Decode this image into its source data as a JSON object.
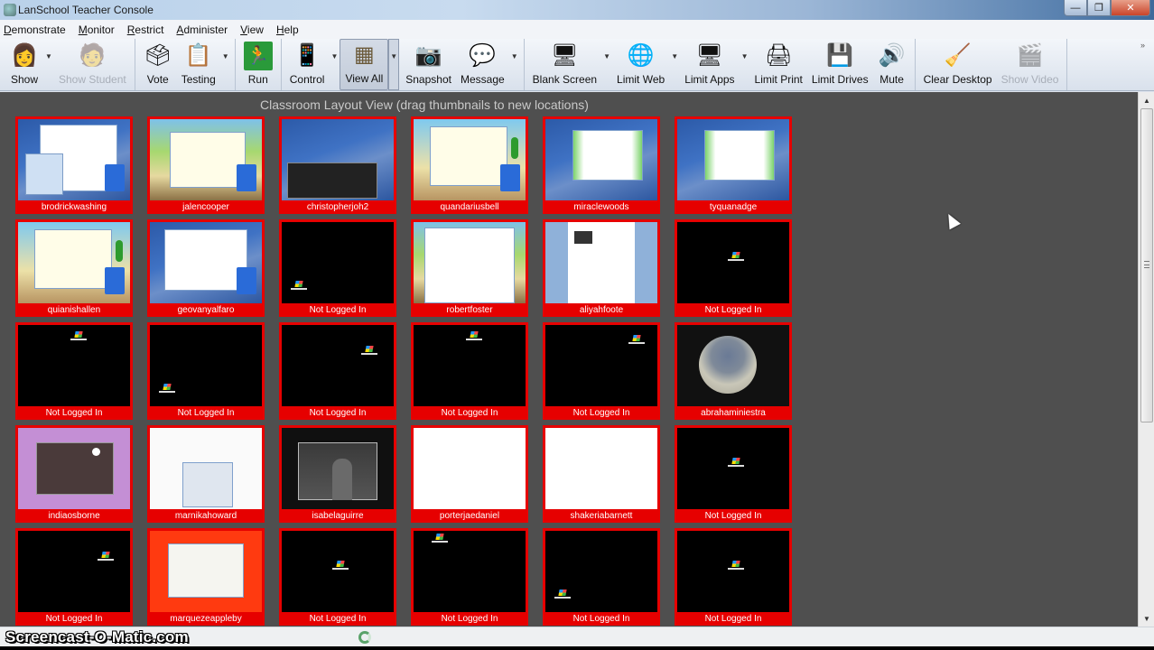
{
  "window": {
    "title": "LanSchool Teacher Console",
    "controls": {
      "minimize": "—",
      "restore": "❐",
      "close": "✕"
    }
  },
  "menu": [
    "Demonstrate",
    "Monitor",
    "Restrict",
    "Administer",
    "View",
    "Help"
  ],
  "toolbar": {
    "show": {
      "label": "Show",
      "icon": "teacher-screen-icon",
      "glyph": "👩"
    },
    "show_student": {
      "label": "Show Student",
      "icon": "student-screen-icon",
      "glyph": "🧑",
      "disabled": true
    },
    "vote": {
      "label": "Vote",
      "icon": "vote-icon",
      "glyph": "🗳"
    },
    "testing": {
      "label": "Testing",
      "icon": "testing-icon",
      "glyph": "📋"
    },
    "run": {
      "label": "Run",
      "icon": "run-exit-icon",
      "glyph": "🏃"
    },
    "control": {
      "label": "Control",
      "icon": "remote-control-icon",
      "glyph": "📱"
    },
    "view_all": {
      "label": "View All",
      "icon": "view-all-grid-icon",
      "glyph": "▦",
      "active": true
    },
    "snapshot": {
      "label": "Snapshot",
      "icon": "camera-icon",
      "glyph": "📷"
    },
    "message": {
      "label": "Message",
      "icon": "message-icon",
      "glyph": "💬"
    },
    "blank_screen": {
      "label": "Blank Screen",
      "icon": "blank-screen-lock-icon",
      "glyph": "🖥"
    },
    "limit_web": {
      "label": "Limit Web",
      "icon": "globe-block-icon",
      "glyph": "🌐"
    },
    "limit_apps": {
      "label": "Limit Apps",
      "icon": "apps-block-icon",
      "glyph": "🖥"
    },
    "limit_print": {
      "label": "Limit Print",
      "icon": "printer-block-icon",
      "glyph": "🖨"
    },
    "limit_drives": {
      "label": "Limit Drives",
      "icon": "drive-block-icon",
      "glyph": "💾"
    },
    "mute": {
      "label": "Mute",
      "icon": "speaker-icon",
      "glyph": "🔊"
    },
    "clear_desktop": {
      "label": "Clear Desktop",
      "icon": "broom-desktop-icon",
      "glyph": "🧹"
    },
    "show_video": {
      "label": "Show Video",
      "icon": "video-icon",
      "glyph": "🎬",
      "disabled": true
    },
    "overflow": "»",
    "dropdown": "▼"
  },
  "content": {
    "caption": "Classroom Layout View (drag thumbnails to new locations)",
    "tiles": [
      {
        "label": "brodrickwashing",
        "screen": "math-calculator"
      },
      {
        "label": "jalencooper",
        "screen": "game-window"
      },
      {
        "label": "christopherjoh2",
        "screen": "xp-video"
      },
      {
        "label": "quandariusbell",
        "screen": "desert-game"
      },
      {
        "label": "miraclewoods",
        "screen": "xp-game"
      },
      {
        "label": "tyquanadge",
        "screen": "xp-game"
      },
      {
        "label": "quianishallen",
        "screen": "desert-game"
      },
      {
        "label": "geovanyalfaro",
        "screen": "xp-math"
      },
      {
        "label": "Not Logged In",
        "screen": "black-logo-bl"
      },
      {
        "label": "robertfoster",
        "screen": "game-doc"
      },
      {
        "label": "aliyahfoote",
        "screen": "word-doc"
      },
      {
        "label": "Not Logged In",
        "screen": "black-logo-center"
      },
      {
        "label": "Not Logged In",
        "screen": "black-logo-top"
      },
      {
        "label": "Not Logged In",
        "screen": "black-logo-bl"
      },
      {
        "label": "Not Logged In",
        "screen": "black-logo-right"
      },
      {
        "label": "Not Logged In",
        "screen": "black-logo-top"
      },
      {
        "label": "Not Logged In",
        "screen": "black-logo-tr"
      },
      {
        "label": "abrahaminiestra",
        "screen": "sniper-game"
      },
      {
        "label": "indiaosborne",
        "screen": "purple-drawing"
      },
      {
        "label": "marnikahoward",
        "screen": "reading-doc"
      },
      {
        "label": "isabelaguirre",
        "screen": "video-person"
      },
      {
        "label": "porterjaedaniel",
        "screen": "white-quiz"
      },
      {
        "label": "shakeriabarnett",
        "screen": "white-quiz"
      },
      {
        "label": "Not Logged In",
        "screen": "black-logo-center"
      },
      {
        "label": "Not Logged In",
        "screen": "black-logo-right"
      },
      {
        "label": "marquezeappleby",
        "screen": "red-slide"
      },
      {
        "label": "Not Logged In",
        "screen": "black-logo-center"
      },
      {
        "label": "Not Logged In",
        "screen": "black-logo-tl"
      },
      {
        "label": "Not Logged In",
        "screen": "black-logo-bl"
      },
      {
        "label": "Not Logged In",
        "screen": "black-logo-center"
      }
    ]
  },
  "colors": {
    "tile_border": "#e60000",
    "workspace": "#4f4f4f"
  },
  "watermark": "Screencast-O-Matic.com"
}
